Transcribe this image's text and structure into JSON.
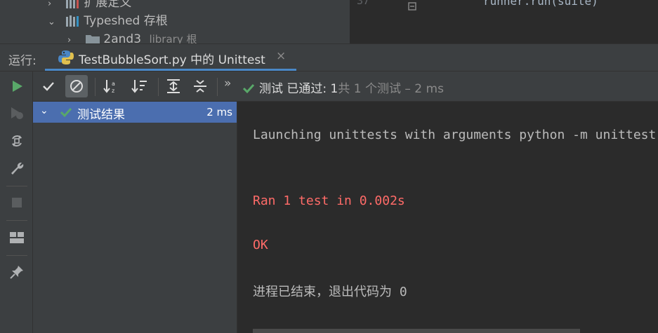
{
  "project_tree": {
    "row1": "扩展定义",
    "row2": "Typeshed 存根",
    "row3_name": "2and3",
    "row3_hint": "library 根"
  },
  "editor": {
    "line_number": "37",
    "code": "runner.run(suite)"
  },
  "run_panel": {
    "label": "运行:",
    "tab_title": "TestBubbleSort.py 中的 Unittest",
    "close_glyph": "×"
  },
  "toolbar": {
    "more_glyph": "»",
    "status_passed": "测试 已通过: 1",
    "status_total": "共 1 个测试 – 2 ms"
  },
  "test_tree": {
    "root_label": "测试结果",
    "root_duration": "2 ms"
  },
  "console": {
    "line1": "Launching unittests with arguments python -m unittest",
    "line2": "Ran 1 test in 0.002s",
    "line3": "OK",
    "line4": "进程已结束，退出代码为 0"
  },
  "colors": {
    "accent_blue": "#4a88c7",
    "selection": "#4b6eaf",
    "pass_green": "#59a869",
    "stderr_red": "#ff6b68"
  }
}
